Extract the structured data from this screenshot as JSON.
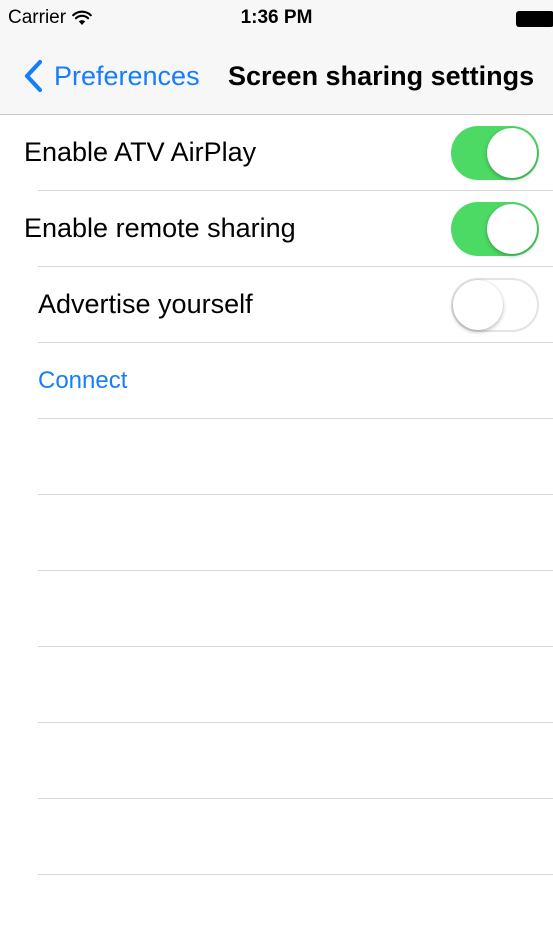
{
  "status_bar": {
    "carrier": "Carrier",
    "time": "1:36 PM",
    "wifi_icon": "wifi-icon",
    "battery_icon": "battery-icon"
  },
  "nav_bar": {
    "back_label": "Preferences",
    "back_icon": "chevron-left-icon",
    "title": "Screen sharing settings"
  },
  "settings": {
    "enable_atv_airplay": {
      "label": "Enable ATV AirPlay",
      "on": true
    },
    "enable_remote_sharing": {
      "label": "Enable remote sharing",
      "on": true
    },
    "advertise_yourself": {
      "label": "Advertise yourself",
      "on": false
    },
    "connect": {
      "label": "Connect"
    }
  },
  "colors": {
    "accent": "#157efb",
    "switch_on": "#4cd964",
    "separator": "#d8d8dc",
    "nav_background": "#f7f7f8"
  }
}
